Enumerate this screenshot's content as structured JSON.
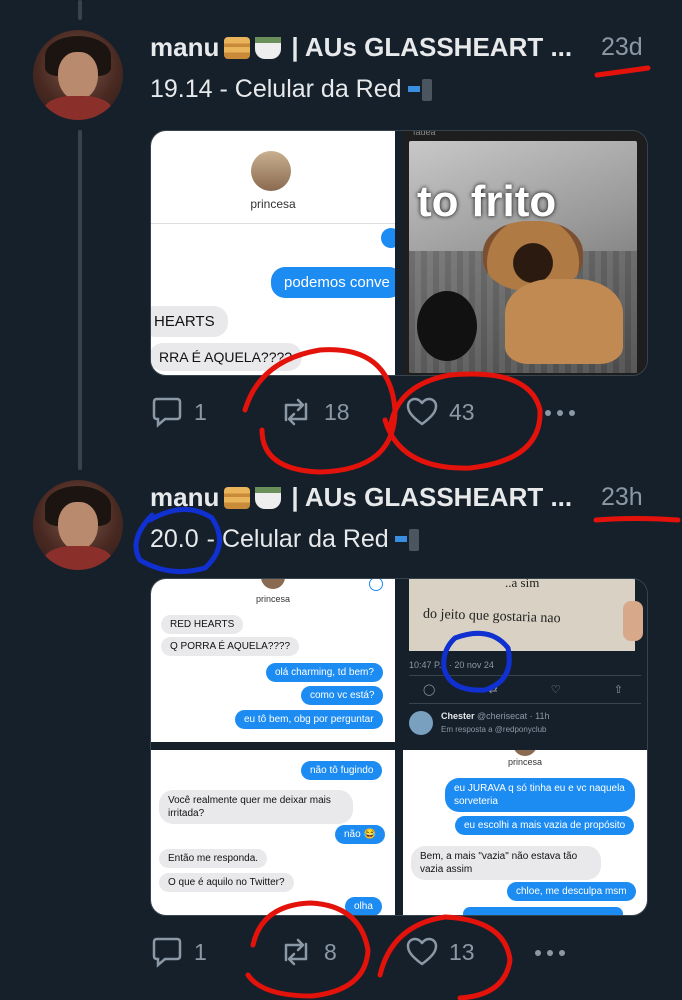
{
  "tweets": [
    {
      "author": "manu",
      "handle_suffix": "| AUs GLASSHEART ...",
      "time": "23d",
      "text_prefix": "19.14 - Celular da Red",
      "text_version": "19.14",
      "media": {
        "left_profile_name": "princesa",
        "left_messages": [
          "podemos conve",
          "HEARTS",
          "RRA É AQUELA????"
        ],
        "right_caption": "to frito",
        "right_top_label": "fadea"
      },
      "replies": "1",
      "retweets": "18",
      "likes": "43"
    },
    {
      "author": "manu",
      "handle_suffix": "| AUs GLASSHEART ...",
      "time": "23h",
      "text_version": "20.0",
      "text_rest": "- Celular da Red",
      "media": {
        "tl_profile_name": "princesa",
        "tl_messages": [
          "RED HEARTS",
          "Q PORRA É AQUELA????",
          "olá charming, td bem?",
          "como vc está?",
          "eu tô bem, obg por perguntar"
        ],
        "tr_sign_top": "..a sim",
        "tr_sign_text": "do jeito que gostaria nao",
        "tr_timestamp": "10:47 P... · 20 nov 24",
        "tr_reply_name": "Chester",
        "tr_reply_handle": "@cherisecat · 11h",
        "tr_reply_to": "Em resposta a @redponyclub",
        "bl_messages": [
          "não tô fugindo",
          "Você realmente quer me deixar mais irritada?",
          "não 😂",
          "Então me responda.",
          "O que é aquilo no Twitter?",
          "olha"
        ],
        "br_profile_name": "princesa",
        "br_messages": [
          "eu JURAVA q só tinha eu e vc naquela sorveteria",
          "eu escolhi a mais vazia de propósito",
          "Bem, a mais \"vazia\" não estava tão vazia assim",
          "chloe, me desculpa msm"
        ]
      },
      "replies": "1",
      "retweets": "8",
      "likes": "13"
    }
  ],
  "colors": {
    "background": "#15202b",
    "muted": "#8b98a5",
    "bubble_blue": "#1d8cf2",
    "annotation_red": "#e3120b",
    "annotation_blue": "#1030d0"
  },
  "icons": [
    "reply-icon",
    "retweet-icon",
    "like-icon",
    "more-icon",
    "pancake-emoji",
    "tea-emoji",
    "phone-arrow-emoji"
  ]
}
